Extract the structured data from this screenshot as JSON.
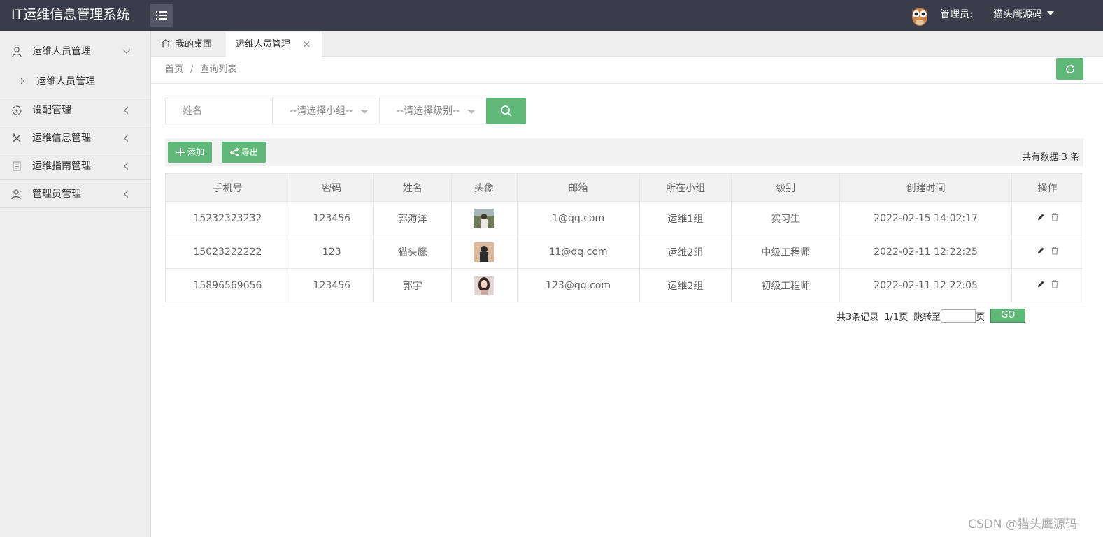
{
  "header": {
    "title": "IT运维信息管理系统",
    "admin_label": "管理员:",
    "admin_name": "猫头鹰源码"
  },
  "sidebar": {
    "groups": [
      {
        "label": "运维人员管理",
        "icon": "user-icon",
        "expanded": true,
        "sub": [
          "运维人员管理"
        ]
      },
      {
        "label": "设配管理",
        "icon": "device-icon"
      },
      {
        "label": "运维信息管理",
        "icon": "tools-icon"
      },
      {
        "label": "运维指南管理",
        "icon": "document-icon"
      },
      {
        "label": "管理员管理",
        "icon": "admin-icon"
      }
    ]
  },
  "tabs": {
    "home": "我的桌面",
    "active": "运维人员管理",
    "close": "×"
  },
  "breadcrumb": {
    "home": "首页",
    "sep": "/",
    "current": "查询列表"
  },
  "search": {
    "name_placeholder": "姓名",
    "group_select": "--请选择小组--",
    "level_select": "--请选择级别--"
  },
  "toolbar": {
    "add": "添加",
    "export": "导出",
    "total": "共有数据:3 条"
  },
  "table": {
    "headers": [
      "手机号",
      "密码",
      "姓名",
      "头像",
      "邮箱",
      "所在小组",
      "级别",
      "创建时间",
      "操作"
    ],
    "rows": [
      {
        "phone": "15232323232",
        "password": "123456",
        "name": "郭海洋",
        "email": "1@qq.com",
        "group": "运维1组",
        "level": "实习生",
        "created": "2022-02-15 14:02:17"
      },
      {
        "phone": "15023222222",
        "password": "123",
        "name": "猫头鹰",
        "email": "11@qq.com",
        "group": "运维2组",
        "level": "中级工程师",
        "created": "2022-02-11 12:22:25"
      },
      {
        "phone": "15896569656",
        "password": "123456",
        "name": "郭宇",
        "email": "123@qq.com",
        "group": "运维2组",
        "level": "初级工程师",
        "created": "2022-02-11 12:22:05"
      }
    ]
  },
  "pager": {
    "records": "共3条记录",
    "pages": "1/1页",
    "jump": "跳转至",
    "page_unit": "页",
    "go": "GO",
    "input_value": ""
  },
  "watermark": "CSDN @猫头鹰源码",
  "colors": {
    "header_bg": "#393d49",
    "accent_green": "#5fb878",
    "sidebar_bg": "#eeeeee"
  }
}
